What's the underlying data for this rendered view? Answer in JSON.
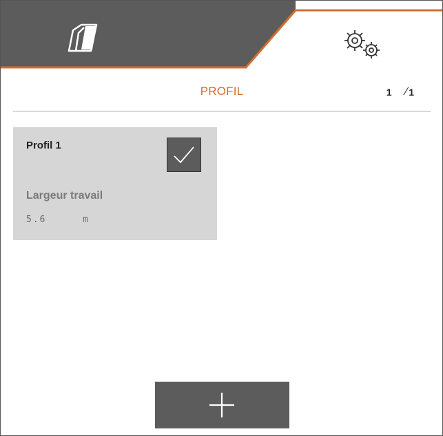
{
  "tabs": [
    {
      "icon": "machine-icon",
      "active": false
    },
    {
      "icon": "settings-gears-icon",
      "active": true
    }
  ],
  "colors": {
    "accent": "#d66d2e",
    "dark": "#5c5c5c",
    "card": "#d6d6d6"
  },
  "header": {
    "title": "PROFIL",
    "page_current": "1",
    "page_separator": "⁄",
    "page_total": "1"
  },
  "profiles": [
    {
      "name": "Profil 1",
      "selected": true,
      "param_label": "Largeur travail",
      "param_value": "5.6",
      "param_unit": "m"
    }
  ],
  "add_button": {
    "icon": "plus-icon"
  }
}
